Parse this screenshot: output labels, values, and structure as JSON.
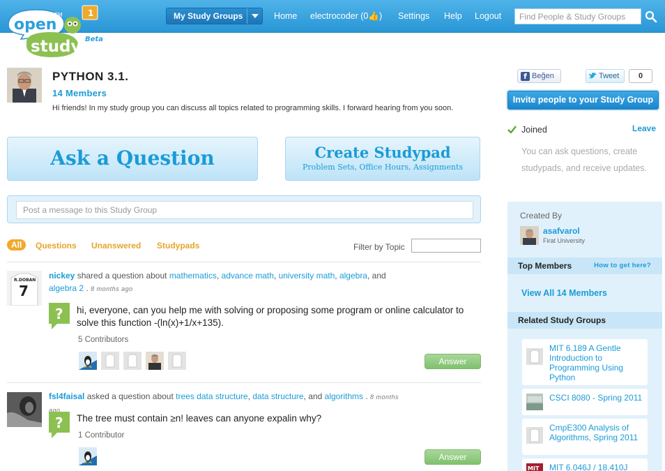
{
  "app": {
    "logo_line1": "open",
    "logo_line2": "study",
    "logo_tm": "TM",
    "logo_beta": "Beta",
    "logo_badge": "1"
  },
  "header": {
    "my_study_groups": "My Study Groups",
    "nav": {
      "home": "Home",
      "user": "electrocoder (0",
      "user_suffix": ")",
      "settings": "Settings",
      "help": "Help",
      "logout": "Logout"
    },
    "search_placeholder": "Find People & Study Groups"
  },
  "group": {
    "title": "PYTHON 3.1.",
    "members": "14 Members",
    "description": "Hi friends! In my study group you can discuss all topics related to programming skills. I forward hearing from you soon."
  },
  "actions": {
    "ask": "Ask a Question",
    "create_title": "Create Studypad",
    "create_sub": "Problem Sets, Office Hours, Assignments",
    "post_placeholder": "Post a message to this Study Group"
  },
  "filters": {
    "tabs": [
      "All",
      "Questions",
      "Unanswered",
      "Studypads"
    ],
    "filter_label": "Filter by Topic"
  },
  "feed": [
    {
      "user": "nickey",
      "verb": "shared a question about",
      "topics": [
        "mathematics",
        "advance math",
        "university math",
        "algebra"
      ],
      "and": ", and",
      "last_topic": "algebra 2",
      "ago": "8 months ago",
      "question": "hi, everyone, can you help me with solving or proposing some program or online calculator to solve this function -(ln(x)+1/x+135).",
      "contributors": "5 Contributors",
      "answer": "Answer"
    },
    {
      "user": "fsl4faisal",
      "verb": "asked a question about",
      "topics": [
        "trees data structure",
        "data structure"
      ],
      "and": ", and",
      "last_topic": "algorithms",
      "ago": "8 months ago",
      "question": "The tree must contain ≥n! leaves can anyone expalin why?",
      "contributors": "1 Contributor",
      "answer": "Answer"
    }
  ],
  "sidebar": {
    "like": "Beğen",
    "tweet": "Tweet",
    "tweet_count": "0",
    "invite": "Invite people to your Study Group",
    "joined": "Joined",
    "leave": "Leave",
    "joined_desc": "You can ask questions, create studypads, and receive updates.",
    "created_by": "Created By",
    "creator_name": "asafvarol",
    "creator_uni": "Firat University",
    "top_members": "Top Members",
    "how_to": "How to get here?",
    "view_all": "View All 14 Members",
    "related": "Related Study Groups",
    "related_groups": [
      "MIT 6.189 A Gentle Introduction to Programming Using Python",
      "CSCI 8080 - Spring 2011",
      "CmpE300 Analysis of Algorithms, Spring 2011",
      "MIT 6.046J / 18.410J"
    ]
  },
  "colors": {
    "brand_blue": "#2996d6",
    "link_blue": "#1a9bd7",
    "accent_orange": "#f0a92b",
    "answer_green": "#80c16e",
    "logo_green": "#8cc152"
  }
}
